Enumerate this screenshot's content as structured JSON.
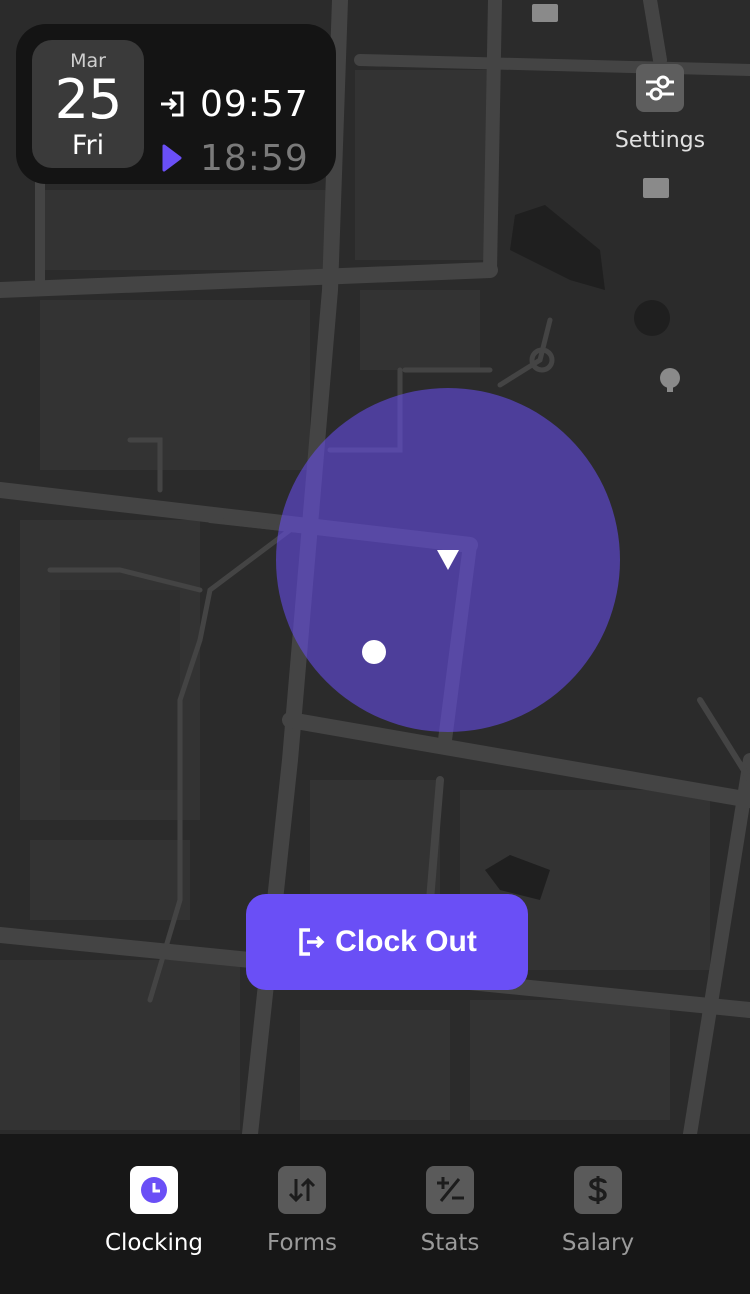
{
  "date_card": {
    "month": "Mar",
    "day": "25",
    "weekday": "Fri",
    "clock_in_time": "09:57",
    "clock_out_time": "18:59",
    "clock_in_icon": "login-arrow-icon",
    "clock_out_icon": "play-triangle-icon"
  },
  "settings": {
    "label": "Settings",
    "icon": "sliders-icon"
  },
  "map": {
    "geofence_color": "#6a4ff6",
    "location_marker": "navigation-arrow-icon",
    "workplace_marker": "white-dot"
  },
  "action": {
    "clock_out_label": "Clock Out",
    "clock_out_icon": "logout-door-icon"
  },
  "nav": {
    "items": [
      {
        "label": "Clocking",
        "icon": "clock-icon",
        "active": true
      },
      {
        "label": "Forms",
        "icon": "arrows-up-down-icon",
        "active": false
      },
      {
        "label": "Stats",
        "icon": "plus-minus-icon",
        "active": false
      },
      {
        "label": "Salary",
        "icon": "dollar-icon",
        "active": false
      }
    ]
  },
  "colors": {
    "accent": "#6a4ff6",
    "map_background": "#2b2b2b",
    "map_roads": "#444444",
    "nav_background": "#171717"
  }
}
